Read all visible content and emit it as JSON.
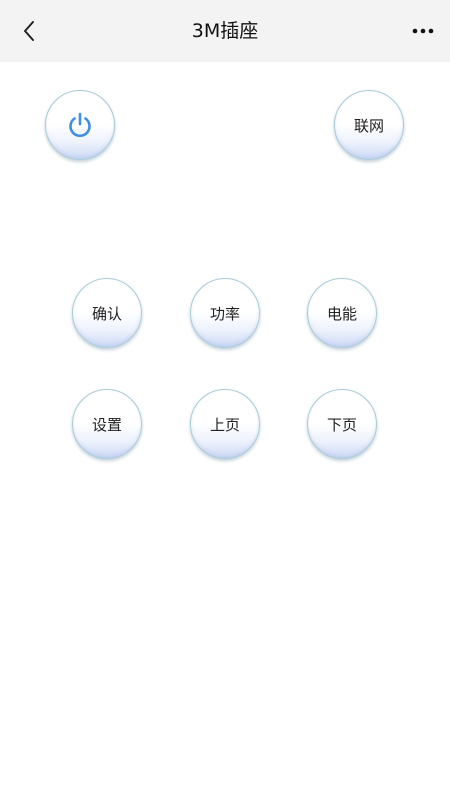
{
  "header": {
    "title": "3M插座",
    "back_icon": "chevron-left-icon",
    "more_icon": "more-horizontal-icon"
  },
  "controls": {
    "power_icon": "power-icon",
    "power_color": "#3d8fe0",
    "network_label": "联网",
    "confirm_label": "确认",
    "power_stat_label": "功率",
    "energy_label": "电能",
    "settings_label": "设置",
    "page_up_label": "上页",
    "page_down_label": "下页"
  }
}
